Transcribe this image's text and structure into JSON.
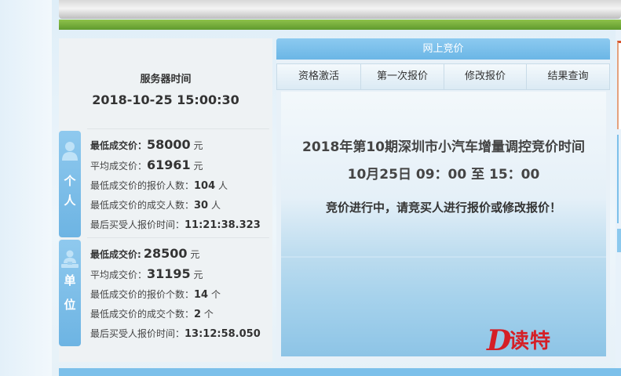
{
  "server_time": {
    "title": "服务器时间",
    "value": "2018-10-25 15:00:30"
  },
  "personal": {
    "tab_label_1": "个",
    "tab_label_2": "人",
    "icon": "person-icon",
    "min_price_label": "最低成交价：",
    "min_price_value": "58000",
    "min_price_unit": "元",
    "avg_price_label": "平均成交价：",
    "avg_price_value": "61961",
    "avg_price_unit": "元",
    "bidders_label": "最低成交价的报价人数：",
    "bidders_value": "104",
    "bidders_unit": "人",
    "winners_label": "最低成交价的成交人数：",
    "winners_value": "30",
    "winners_unit": "人",
    "last_time_label": "最后买受人报价时间：",
    "last_time_value": "11:21:38.323"
  },
  "unit": {
    "tab_label_1": "单",
    "tab_label_2": "位",
    "icon": "group-icon",
    "min_price_label": "最低成交价:",
    "min_price_value": "28500",
    "min_price_unit": "元",
    "avg_price_label": "平均成交价：",
    "avg_price_value": "31195",
    "avg_price_unit": "元",
    "bidders_label": "最低成交价的报价个数：",
    "bidders_value": "14",
    "bidders_unit": "个",
    "winners_label": "最低成交价的成交个数：",
    "winners_value": "2",
    "winners_unit": "个",
    "last_time_label": "最后买受人报价时间：",
    "last_time_value": "13:12:58.050"
  },
  "auction": {
    "header": "网上竞价",
    "tabs": [
      {
        "label": "资格激活"
      },
      {
        "label": "第一次报价"
      },
      {
        "label": "修改报价"
      },
      {
        "label": "结果查询"
      }
    ],
    "notice_title": "2018年第10期深圳市小汽车增量调控竞价时间",
    "notice_time": "10月25日 09：00 至 15：00",
    "notice_status": "竞价进行中，请竞买人进行报价或修改报价！"
  },
  "watermark": {
    "mark": "D",
    "text": "读特"
  },
  "colors": {
    "accent": "#6db4e3",
    "logo_red": "#d51f26"
  }
}
